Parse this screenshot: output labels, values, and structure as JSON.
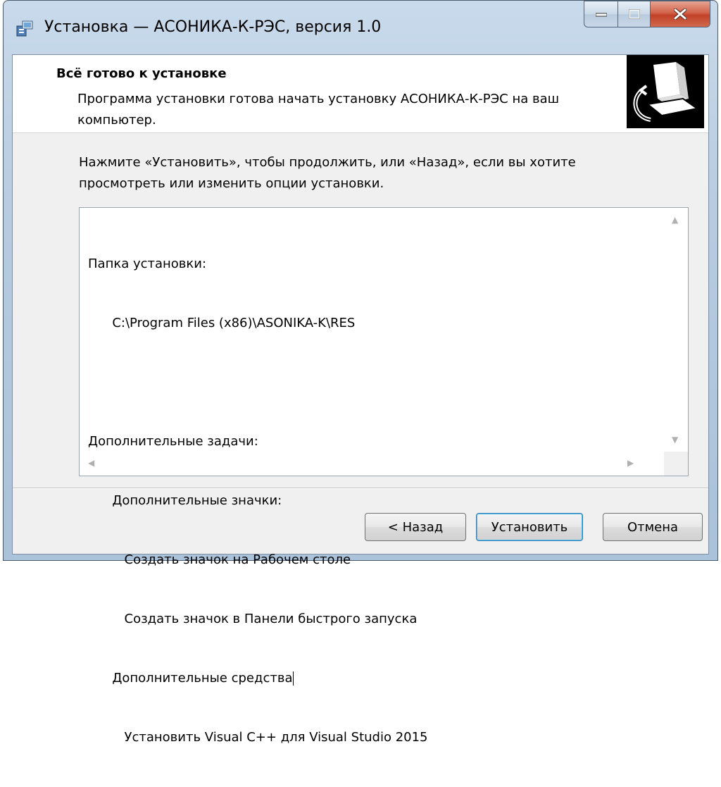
{
  "window": {
    "title": "Установка — АСОНИКА-К-РЭС, версия 1.0"
  },
  "header": {
    "title": "Всё готово к установке",
    "description": "Программа установки готова начать установку АСОНИКА-К-РЭС на ваш компьютер."
  },
  "main": {
    "instructions": "Нажмите «Установить», чтобы продолжить, или «Назад», если вы хотите просмотреть или изменить опции установки.",
    "memo": {
      "lines": [
        "Папка установки:",
        "      C:\\Program Files (x86)\\ASONIKA-K\\RES",
        "",
        "Дополнительные задачи:",
        "      Дополнительные значки:",
        "         Создать значок на Рабочем столе",
        "         Создать значок в Панели быстрого запуска",
        "      Дополнительные средства",
        "         Установить Visual C++ для Visual Studio 2015"
      ]
    }
  },
  "buttons": {
    "back": "< Назад",
    "install": "Установить",
    "cancel": "Отмена"
  },
  "icons": {
    "app": "installer-icon",
    "header": "computer-install-icon"
  }
}
